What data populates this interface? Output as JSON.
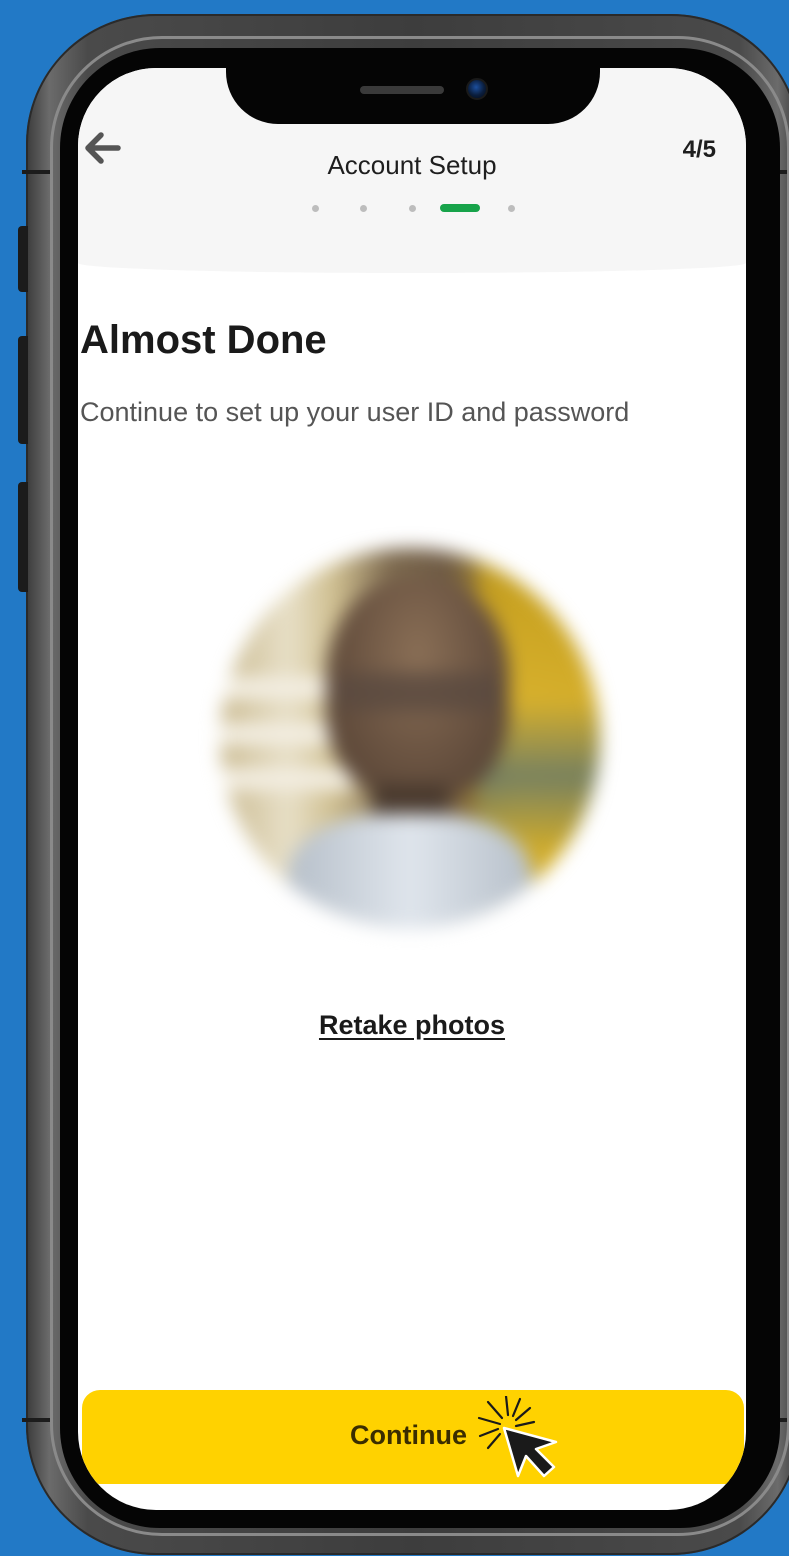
{
  "header": {
    "title": "Account Setup",
    "step_counter": "4/5",
    "back_icon": "arrow-left-icon"
  },
  "progress": {
    "steps": 5,
    "current": 4
  },
  "main": {
    "heading": "Almost Done",
    "subtitle": "Continue to set up your user ID and password",
    "photo": "selfie-photo",
    "retake_label": "Retake photos"
  },
  "footer": {
    "continue_label": "Continue",
    "cursor_icon": "click-cursor-icon"
  },
  "colors": {
    "background": "#2279c6",
    "accent_button": "#ffd200",
    "progress_active": "#17a34a"
  }
}
